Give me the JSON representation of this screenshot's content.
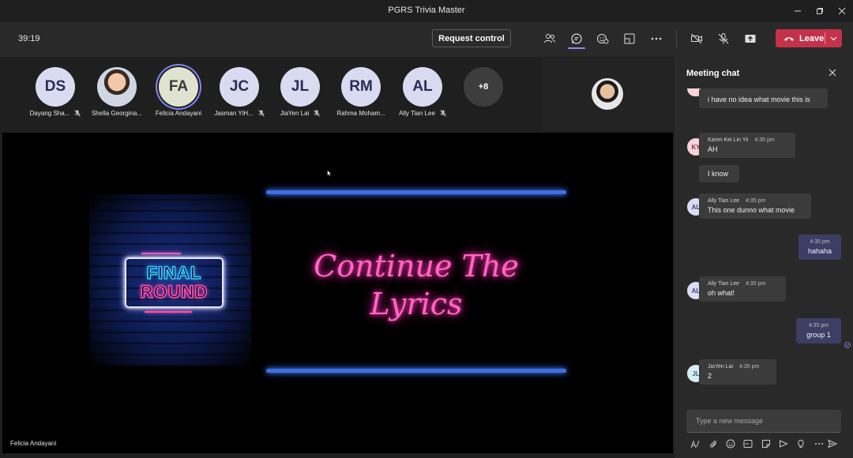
{
  "window": {
    "title": "PGRS Trivia Master"
  },
  "toolbar": {
    "timer": "39:19",
    "request_control_label": "Request control",
    "leave_label": "Leave"
  },
  "participants": [
    {
      "initials": "DS",
      "name": "Dayang Sha...",
      "muted": true
    },
    {
      "initials": "",
      "name": "Shella Georgina...",
      "muted": false,
      "photo": true
    },
    {
      "initials": "FA",
      "name": "Felicia Andayani",
      "muted": false,
      "speaking": true
    },
    {
      "initials": "JC",
      "name": "Jasman YiH...",
      "muted": true
    },
    {
      "initials": "JL",
      "name": "JiaYen Lai",
      "muted": true
    },
    {
      "initials": "RM",
      "name": "Rahma Moham...",
      "muted": false
    },
    {
      "initials": "AL",
      "name": "Ally Tian Lee",
      "muted": true
    },
    {
      "initials": "+8",
      "name": "",
      "muted": false,
      "more": true
    }
  ],
  "stage": {
    "presenter_name": "Felicia Andayani",
    "final_line1": "FINAL",
    "final_line2": "ROUND",
    "neon_line1": "Continue The",
    "neon_line2": "Lyrics"
  },
  "chat": {
    "title": "Meeting chat",
    "compose_placeholder": "Type a new message",
    "messages": [
      {
        "text": "i have no idea what movie this is"
      },
      {
        "sender": "Karen Kei Lin Yii",
        "time": "4:35 pm",
        "text": "AH",
        "initials": "KY"
      },
      {
        "text": "I know"
      },
      {
        "sender": "Ally Tian Lee",
        "time": "4:35 pm",
        "text": "This one dunno what movie",
        "initials": "AL"
      },
      {
        "time": "4:35 pm",
        "text": "hahaha",
        "me": true
      },
      {
        "sender": "Ally Tian Lee",
        "time": "4:35 pm",
        "text": "oh what!",
        "initials": "AL"
      },
      {
        "time": "4:35 pm",
        "text": "group 1",
        "me": true
      },
      {
        "sender": "JiaYen Lai",
        "time": "4:35 pm",
        "text": "2",
        "initials": "JL"
      }
    ]
  },
  "colors": {
    "accent": "#7f85f5",
    "leave": "#c4314b",
    "neon_pink": "#ff66c4",
    "neon_blue": "#3f6fe0"
  }
}
